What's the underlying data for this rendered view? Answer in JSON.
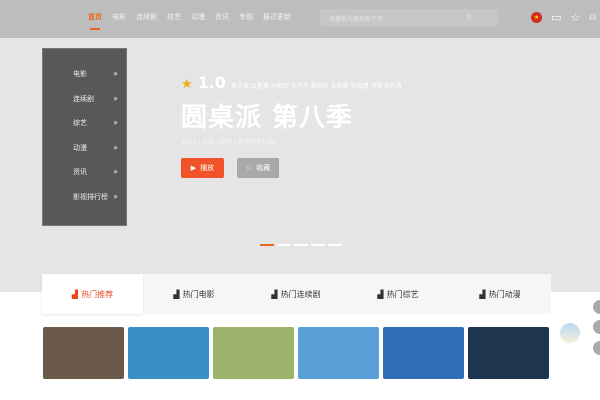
{
  "header": {
    "nav": [
      "首页",
      "电影",
      "连续剧",
      "综艺",
      "动漫",
      "资讯",
      "专题",
      "最近更新"
    ],
    "active": 0,
    "search_placeholder": "海量影片随你看不停"
  },
  "sidebar": [
    "电影",
    "连续剧",
    "综艺",
    "动漫",
    "资讯",
    "影视排行榜"
  ],
  "hero": {
    "score": "1.0",
    "cast": "窦文涛 吕鲁豫 马家辉 许子东 高晓松 余秋雨 李玫瑾 刘擎 陈丹青",
    "title": "圆桌派 第八季",
    "meta": "2024 / 大陆 / 综艺 / 更新至第10期",
    "play_label": "播放",
    "fav_label": "收藏",
    "slides": 5,
    "active_slide": 1
  },
  "tabs": [
    "热门推荐",
    "热门电影",
    "热门连续剧",
    "热门综艺",
    "热门动漫"
  ],
  "accent": "#e8661f",
  "posters": [
    "#6b5a4a",
    "#3a8fc6",
    "#9bb36a",
    "#5aa0d8",
    "#2f6fb8",
    "#1e3550"
  ]
}
